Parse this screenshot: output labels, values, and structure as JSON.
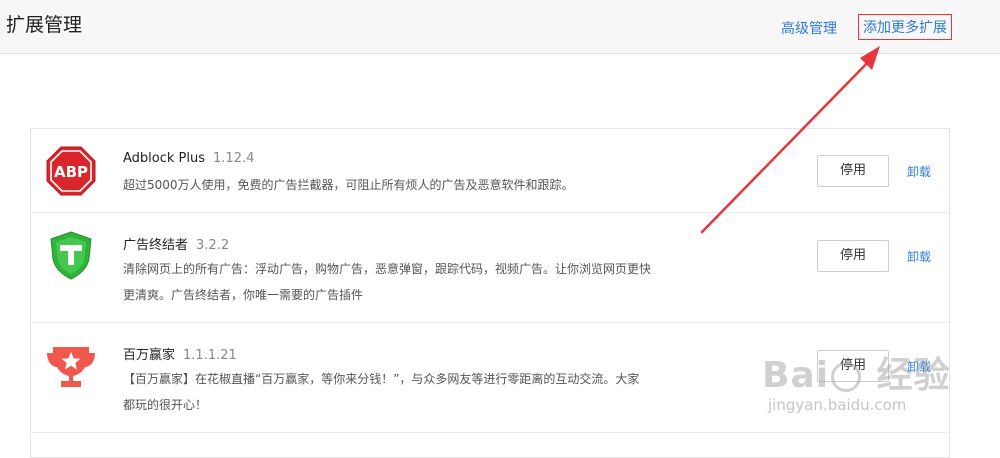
{
  "header": {
    "title": "扩展管理",
    "advanced_link": "高级管理",
    "add_more_link": "添加更多扩展"
  },
  "extensions": [
    {
      "name": "Adblock Plus",
      "version": "1.12.4",
      "description_lines": [
        "超过5000万人使用，免费的广告拦截器，可阻止所有烦人的广告及恶意软件和跟踪。"
      ],
      "disable_label": "停用",
      "uninstall_label": "卸载",
      "icon": "abp-stop-sign-icon",
      "icon_color": "#d9262b"
    },
    {
      "name": "广告终结者",
      "version": "3.2.2",
      "description_lines": [
        "清除网页上的所有广告：浮动广告，购物广告，恶意弹窗，跟踪代码，视频广告。让你浏览网页更快",
        "更清爽。广告终结者，你唯一需要的广告插件"
      ],
      "disable_label": "停用",
      "uninstall_label": "卸载",
      "icon": "green-t-shield-icon",
      "icon_color": "#2fb33b"
    },
    {
      "name": "百万赢家",
      "version": "1.1.1.21",
      "description_lines": [
        "【百万赢家】在花椒直播“百万赢家，等你来分钱！”，与众多网友等进行零距离的互动交流。大家",
        "都玩的很开心！"
      ],
      "disable_label": "停用",
      "uninstall_label": "卸载",
      "icon": "trophy-star-icon",
      "icon_color": "#f0584e"
    }
  ],
  "annotation": {
    "arrow_color": "#e8343a"
  },
  "watermark": {
    "logo_text": "Bai 经验",
    "sub_text": "jingyan.baidu.com"
  }
}
